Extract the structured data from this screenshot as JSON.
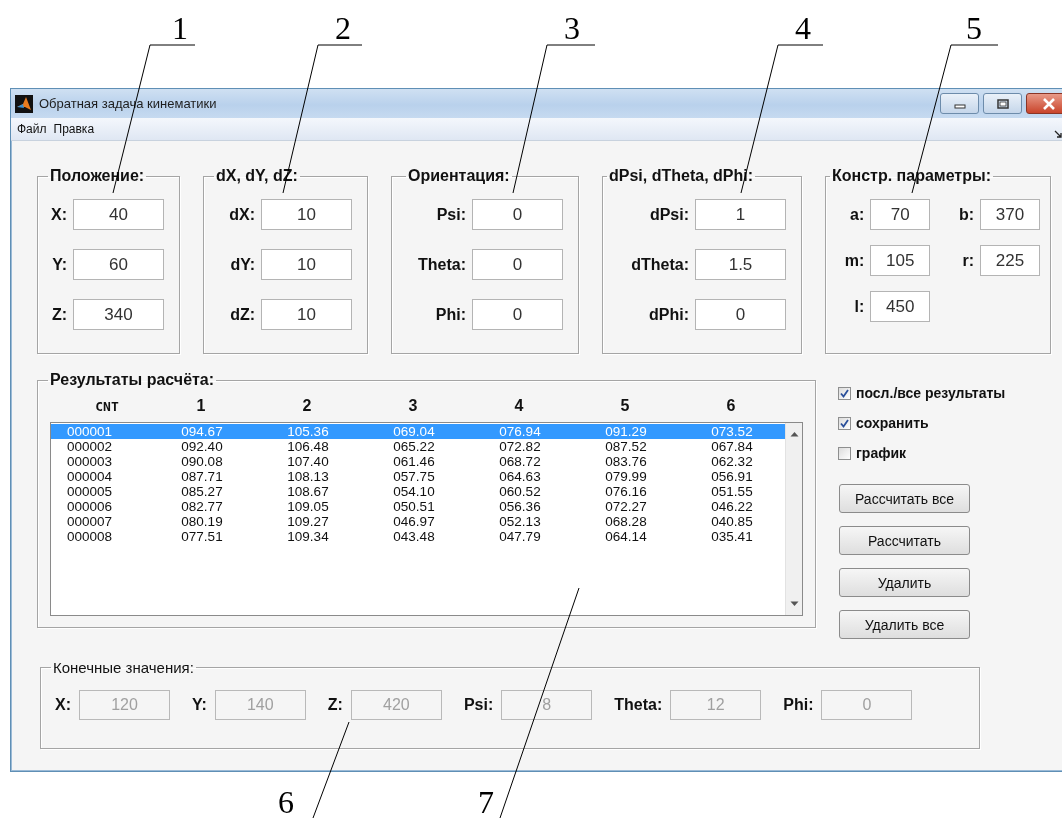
{
  "callouts": [
    {
      "label": "1"
    },
    {
      "label": "2"
    },
    {
      "label": "3"
    },
    {
      "label": "4"
    },
    {
      "label": "5"
    },
    {
      "label": "6"
    },
    {
      "label": "7"
    }
  ],
  "window": {
    "title": "Обратная задача кинематики"
  },
  "menu": [
    "Файл",
    "Правка"
  ],
  "panels": [
    {
      "title": "Положение:",
      "kind": "column",
      "fields": [
        {
          "label": "X:",
          "value": "40"
        },
        {
          "label": "Y:",
          "value": "60"
        },
        {
          "label": "Z:",
          "value": "340"
        }
      ]
    },
    {
      "title": "dX, dY, dZ:",
      "kind": "column",
      "fields": [
        {
          "label": "dX:",
          "value": "10"
        },
        {
          "label": "dY:",
          "value": "10"
        },
        {
          "label": "dZ:",
          "value": "10"
        }
      ]
    },
    {
      "title": "Ориентация:",
      "kind": "column",
      "fields": [
        {
          "label": "Psi:",
          "value": "0"
        },
        {
          "label": "Theta:",
          "value": "0"
        },
        {
          "label": "Phi:",
          "value": "0"
        }
      ]
    },
    {
      "title": "dPsi, dTheta, dPhi:",
      "kind": "column",
      "fields": [
        {
          "label": "dPsi:",
          "value": "1"
        },
        {
          "label": "dTheta:",
          "value": "1.5"
        },
        {
          "label": "dPhi:",
          "value": "0"
        }
      ]
    },
    {
      "title": "Констр. параметры:",
      "kind": "grid",
      "fields": [
        {
          "label": "a:",
          "value": "70"
        },
        {
          "label": "b:",
          "value": "370"
        },
        {
          "label": "m:",
          "value": "105"
        },
        {
          "label": "r:",
          "value": "225"
        },
        {
          "label": "l:",
          "value": "450"
        }
      ]
    }
  ],
  "results": {
    "title": "Результаты расчёта:",
    "columns": [
      "CNT",
      "1",
      "2",
      "3",
      "4",
      "5",
      "6"
    ],
    "rows": [
      {
        "cells": [
          "000001",
          "094.67",
          "105.36",
          "069.04",
          "076.94",
          "091.29",
          "073.52"
        ],
        "selected": true
      },
      {
        "cells": [
          "000002",
          "092.40",
          "106.48",
          "065.22",
          "072.82",
          "087.52",
          "067.84"
        ],
        "selected": false
      },
      {
        "cells": [
          "000003",
          "090.08",
          "107.40",
          "061.46",
          "068.72",
          "083.76",
          "062.32"
        ],
        "selected": false
      },
      {
        "cells": [
          "000004",
          "087.71",
          "108.13",
          "057.75",
          "064.63",
          "079.99",
          "056.91"
        ],
        "selected": false
      },
      {
        "cells": [
          "000005",
          "085.27",
          "108.67",
          "054.10",
          "060.52",
          "076.16",
          "051.55"
        ],
        "selected": false
      },
      {
        "cells": [
          "000006",
          "082.77",
          "109.05",
          "050.51",
          "056.36",
          "072.27",
          "046.22"
        ],
        "selected": false
      },
      {
        "cells": [
          "000007",
          "080.19",
          "109.27",
          "046.97",
          "052.13",
          "068.28",
          "040.85"
        ],
        "selected": false
      },
      {
        "cells": [
          "000008",
          "077.51",
          "109.34",
          "043.48",
          "047.79",
          "064.14",
          "035.41"
        ],
        "selected": false
      }
    ]
  },
  "options": [
    {
      "label": "посл./все результаты",
      "checked": true
    },
    {
      "label": "сохранить",
      "checked": true
    },
    {
      "label": "график",
      "checked": false
    }
  ],
  "buttons": [
    "Рассчитать все",
    "Рассчитать",
    "Удалить",
    "Удалить все"
  ],
  "final": {
    "title": "Конечные значения:",
    "fields": [
      {
        "label": "X:",
        "value": "120",
        "disabled": true
      },
      {
        "label": "Y:",
        "value": "140",
        "disabled": true
      },
      {
        "label": "Z:",
        "value": "420",
        "disabled": true
      },
      {
        "label": "Psi:",
        "value": "8",
        "disabled": true
      },
      {
        "label": "Theta:",
        "value": "12",
        "disabled": true
      },
      {
        "label": "Phi:",
        "value": "0",
        "disabled": true
      }
    ]
  }
}
